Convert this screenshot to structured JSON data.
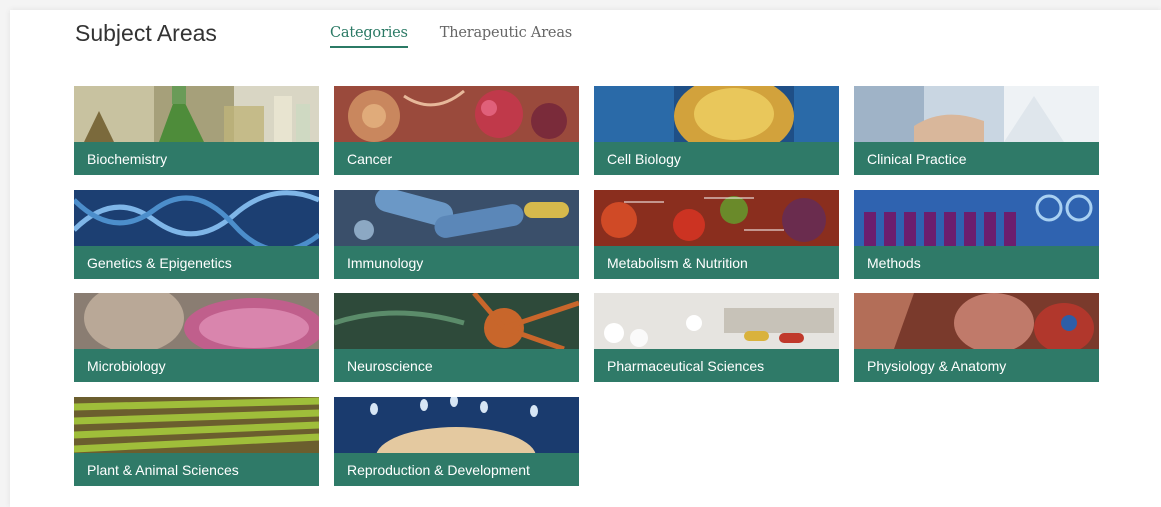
{
  "header": {
    "title": "Subject Areas",
    "tabs": [
      {
        "label": "Categories",
        "active": true
      },
      {
        "label": "Therapeutic Areas",
        "active": false
      }
    ]
  },
  "tiles": [
    {
      "label": "Biochemistry",
      "icon": "biochemistry-image"
    },
    {
      "label": "Cancer",
      "icon": "cancer-image"
    },
    {
      "label": "Cell Biology",
      "icon": "cell-biology-image"
    },
    {
      "label": "Clinical Practice",
      "icon": "clinical-practice-image"
    },
    {
      "label": "Genetics & Epigenetics",
      "icon": "genetics-image"
    },
    {
      "label": "Immunology",
      "icon": "immunology-image"
    },
    {
      "label": "Metabolism & Nutrition",
      "icon": "metabolism-image"
    },
    {
      "label": "Methods",
      "icon": "methods-image"
    },
    {
      "label": "Microbiology",
      "icon": "microbiology-image"
    },
    {
      "label": "Neuroscience",
      "icon": "neuroscience-image"
    },
    {
      "label": "Pharmaceutical Sciences",
      "icon": "pharmaceutical-image"
    },
    {
      "label": "Physiology & Anatomy",
      "icon": "physiology-image"
    },
    {
      "label": "Plant & Animal Sciences",
      "icon": "plant-animal-image"
    },
    {
      "label": "Reproduction & Development",
      "icon": "reproduction-image"
    }
  ],
  "colors": {
    "accent": "#2b7a65",
    "tile_label_bg": "#2f7a68"
  }
}
